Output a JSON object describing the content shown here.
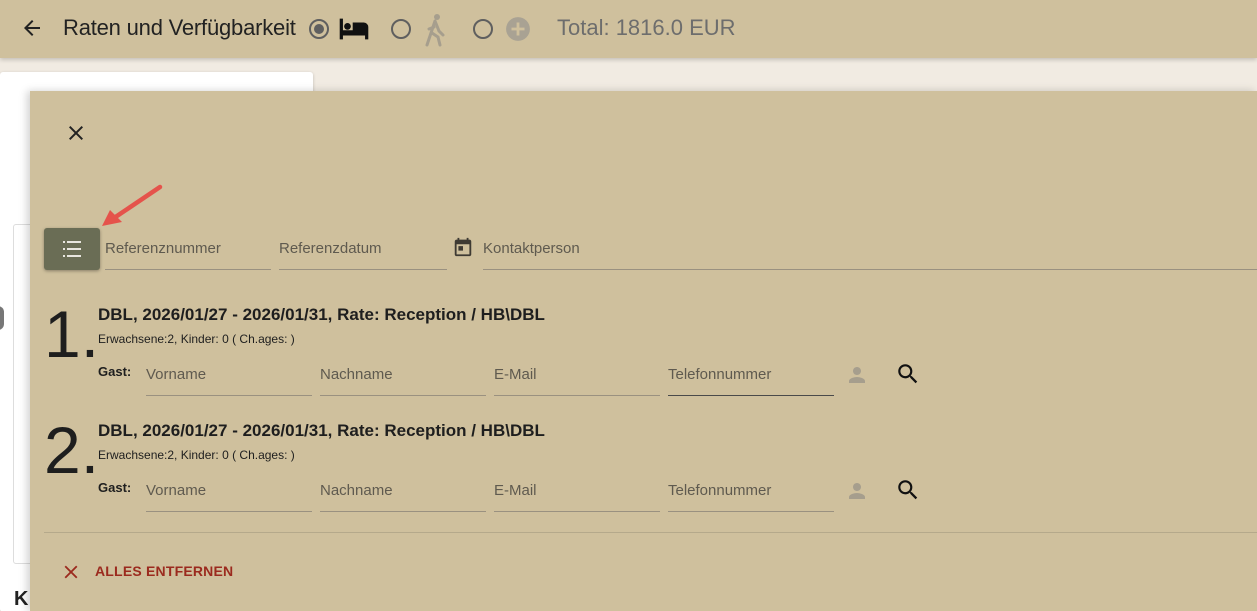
{
  "topbar": {
    "title": "Raten und Verfügbarkeit",
    "total": "Total: 1816.0 EUR",
    "options": [
      {
        "icon": "bed-icon",
        "selected": true
      },
      {
        "icon": "walking-person-icon",
        "selected": false
      },
      {
        "icon": "add-circle-icon",
        "selected": false
      }
    ]
  },
  "background": {
    "partial_text": "K"
  },
  "panel": {
    "fields": {
      "referenznummer": "Referenznummer",
      "referenzdatum": "Referenzdatum",
      "kontaktperson": "Kontaktperson"
    },
    "rooms": [
      {
        "number": "1.",
        "title": "DBL, 2026/01/27 - 2026/01/31, Rate: Reception / HB\\DBL",
        "subtitle": "Erwachsene:2, Kinder: 0 ( Ch.ages: )",
        "guest_label": "Gast:",
        "fields": [
          "Vorname",
          "Nachname",
          "E-Mail",
          "Telefonnummer"
        ]
      },
      {
        "number": "2.",
        "title": "DBL, 2026/01/27 - 2026/01/31, Rate: Reception / HB\\DBL",
        "subtitle": "Erwachsene:2, Kinder: 0 ( Ch.ages: )",
        "guest_label": "Gast:",
        "fields": [
          "Vorname",
          "Nachname",
          "E-Mail",
          "Telefonnummer"
        ]
      }
    ],
    "remove_all_label": "ALLES ENTFERNEN"
  },
  "colors": {
    "panel_bg": "#cfc09d",
    "list_button": "#6a6d55",
    "arrow": "#e5534b",
    "remove": "#9b2a1e"
  }
}
